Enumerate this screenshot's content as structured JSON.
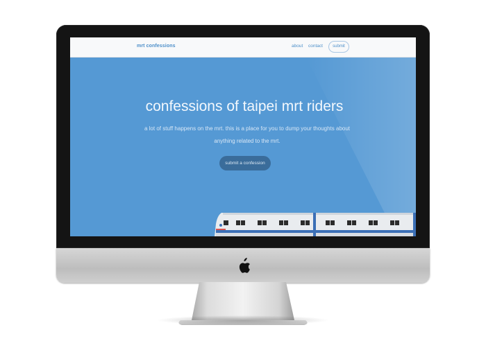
{
  "nav": {
    "brand": "mrt confessions",
    "links": [
      "about",
      "contact"
    ],
    "submit_label": "submit"
  },
  "hero": {
    "title": "confessions of taipei mrt riders",
    "description": "a lot of stuff happens on the mrt. this is a place for you to dump your thoughts about anything related to the mrt.",
    "cta_label": "submit a confession"
  },
  "colors": {
    "hero_bg": "#5599d4",
    "brand": "#4d8fc9",
    "cta_bg": "#3a6c9a",
    "bezel": "#141414",
    "train_stripe": "#3b6fb6"
  },
  "icons": [
    "apple-logo-icon",
    "train-illustration"
  ]
}
